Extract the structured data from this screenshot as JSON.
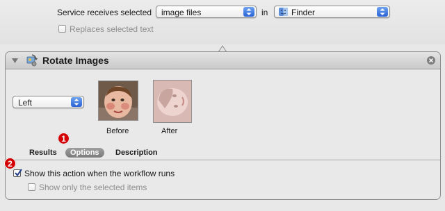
{
  "service": {
    "receives_label": "Service receives selected",
    "input_type": "image files",
    "in_label": "in",
    "application": "Finder",
    "replaces_label": "Replaces selected text",
    "replaces_checked": false
  },
  "action": {
    "title": "Rotate Images",
    "direction": "Left",
    "before_label": "Before",
    "after_label": "After",
    "tabs": [
      {
        "label": "Results",
        "selected": false
      },
      {
        "label": "Options",
        "selected": true
      },
      {
        "label": "Description",
        "selected": false
      }
    ],
    "options": {
      "show_action_label": "Show this action when the workflow runs",
      "show_action_checked": true,
      "show_selected_label": "Show only the selected items",
      "show_selected_checked": false
    }
  },
  "annotations": [
    "1",
    "2"
  ],
  "colors": {
    "popup_arrow": "#2a62d6",
    "badge": "#d40000",
    "selected_tab": "#8a8a8a"
  }
}
